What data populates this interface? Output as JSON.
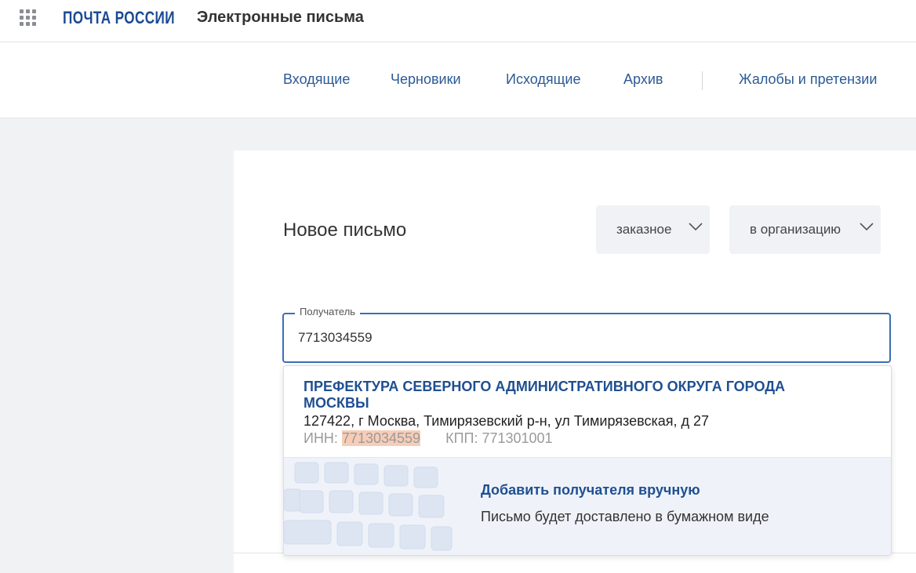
{
  "header": {
    "logo": "ПОЧТА РОССИИ",
    "app_title": "Электронные письма"
  },
  "nav": {
    "items": [
      "Входящие",
      "Черновики",
      "Исходящие",
      "Архив"
    ],
    "complaints": "Жалобы и претензии"
  },
  "compose": {
    "title": "Новое письмо",
    "letter_type": "заказное",
    "recipient_type": "в организацию",
    "recipient_label": "Получатель",
    "recipient_value": "7713034559"
  },
  "suggestion": {
    "name": "ПРЕФЕКТУРА СЕВЕРНОГО АДМИНИСТРАТИВНОГО ОКРУГА ГОРОДА МОСКВЫ",
    "address": "127422, г Москва, Тимирязевский р-н, ул Тимирязевская, д 27",
    "inn_label": "ИНН:",
    "inn": "7713034559",
    "kpp": "КПП: 771301001"
  },
  "manual": {
    "title": "Добавить получателя вручную",
    "description": "Письмо будет доставлено в бумажном виде"
  },
  "colors": {
    "brand": "#1a4a94",
    "link": "#2c5a94",
    "highlight": "#f7cdb8",
    "focus_border": "#3b6fb5"
  },
  "icons": [
    "apps-grid-icon",
    "chevron-down-icon",
    "keyboard-illustration"
  ]
}
